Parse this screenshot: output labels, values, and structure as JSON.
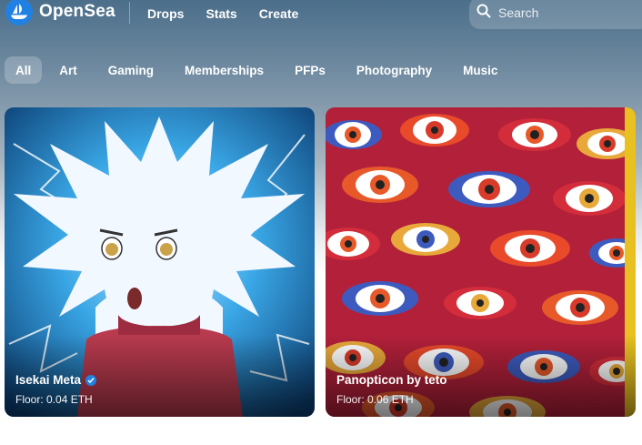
{
  "brand": {
    "name": "OpenSea"
  },
  "nav": {
    "links": [
      "Drops",
      "Stats",
      "Create"
    ]
  },
  "search": {
    "placeholder": "Search",
    "icon": "search-icon"
  },
  "categories": [
    "All",
    "Art",
    "Gaming",
    "Memberships",
    "PFPs",
    "Photography",
    "Music"
  ],
  "selected_category": "All",
  "collections": [
    {
      "name": "Isekai Meta",
      "verified": true,
      "floor": "Floor: 0.04 ETH"
    },
    {
      "name": "Panopticon by teto",
      "verified": false,
      "floor": "Floor: 0.06 ETH"
    }
  ],
  "colors": {
    "accent": "#2081e2",
    "text_on_dark": "#ffffff"
  }
}
